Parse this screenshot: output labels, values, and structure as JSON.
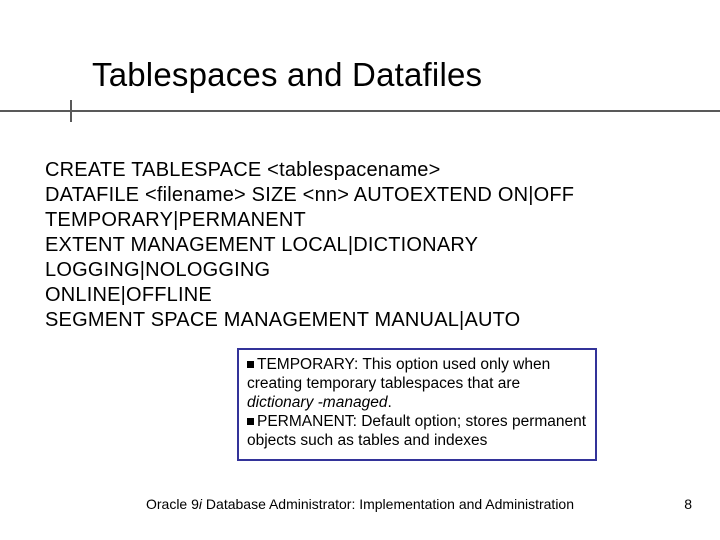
{
  "title": "Tablespaces and Datafiles",
  "body": {
    "l1": "CREATE TABLESPACE <tablespacename>",
    "l2": "DATAFILE <filename> SIZE <nn> AUTOEXTEND ON|OFF",
    "l3": "TEMPORARY|PERMANENT",
    "l4": "EXTENT MANAGEMENT LOCAL|DICTIONARY",
    "l5": "LOGGING|NOLOGGING",
    "l6": "ONLINE|OFFLINE",
    "l7": "SEGMENT SPACE MANAGEMENT MANUAL|AUTO"
  },
  "callout": {
    "b1_a": "TEMPORARY: This option used only when creating temporary tablespaces that are ",
    "b1_b": "dictionary -managed",
    "b1_c": ".",
    "b2": "PERMANENT: Default option; stores permanent objects such as tables and indexes"
  },
  "footer": {
    "prefix": "Oracle 9",
    "i": "i",
    "rest": " Database Administrator: Implementation and Administration"
  },
  "page_number": "8"
}
